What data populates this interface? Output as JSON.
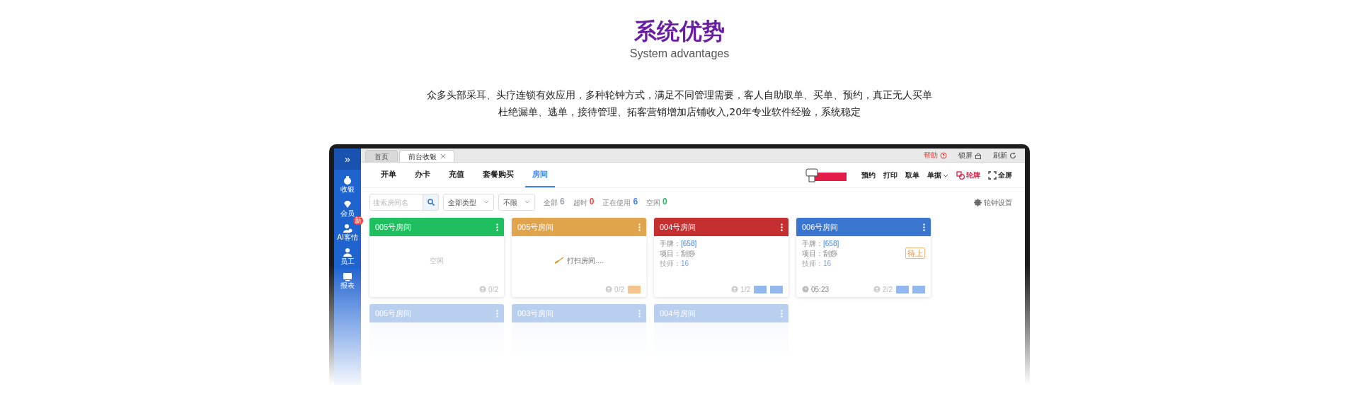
{
  "heading": {
    "title": "系统优势",
    "subtitle": "System advantages",
    "lines": [
      "众多头部采耳、头疗连锁有效应用，多种轮钟方式，满足不同管理需要，客人自助取单、买单、预约，真正无人买单",
      "杜绝漏单、逃单，接待管理、拓客营销增加店铺收入,20年专业软件经验，系统稳定"
    ]
  },
  "app": {
    "sidebar": {
      "toggle": "»",
      "items": [
        {
          "label": "收银"
        },
        {
          "label": "会员"
        },
        {
          "label": "AI客情",
          "badge": "新"
        },
        {
          "label": "员工"
        },
        {
          "label": "报表"
        }
      ]
    },
    "page_tabs": [
      {
        "label": "首页",
        "selected": false
      },
      {
        "label": "前台收银",
        "selected": true,
        "closable": true
      }
    ],
    "top_links": [
      {
        "label": "帮助",
        "kind": "help"
      },
      {
        "label": "锁屏",
        "kind": "lock"
      },
      {
        "label": "刷新",
        "kind": "refresh"
      }
    ],
    "nav_tabs": [
      {
        "label": "开单",
        "selected": false
      },
      {
        "label": "办卡",
        "selected": false
      },
      {
        "label": "充值",
        "selected": false
      },
      {
        "label": "套餐购买",
        "selected": false
      },
      {
        "label": "房间",
        "selected": true
      }
    ],
    "actions": [
      {
        "label": "预约",
        "kind": "plain"
      },
      {
        "label": "打印",
        "kind": "plain"
      },
      {
        "label": "取单",
        "kind": "plain"
      },
      {
        "label": "单据",
        "kind": "dropdown"
      },
      {
        "label": "轮牌",
        "kind": "rotation"
      },
      {
        "label": "全屏",
        "kind": "fullscreen"
      }
    ],
    "filters": {
      "search": {
        "placeholder": "搜索房间名"
      },
      "selects": [
        "全部类型",
        "不限"
      ],
      "counts": [
        {
          "label": "全部",
          "value": "6",
          "color": "#9ca3af"
        },
        {
          "label": "超时",
          "value": "0",
          "color": "#ef4444"
        },
        {
          "label": "正在使用",
          "value": "6",
          "color": "#3b82f6"
        },
        {
          "label": "空闲",
          "value": "0",
          "color": "#22c55e"
        }
      ],
      "settings": "轮钟设置"
    },
    "rooms": [
      {
        "name": "005号房间",
        "color": "#1fbf5f",
        "status": "空闲",
        "kind": "idle",
        "occupancy": "0/2"
      },
      {
        "name": "005号房间",
        "color": "#e0a54c",
        "status": "打扫房间....",
        "kind": "cleaning",
        "occupancy": "0/2",
        "chips": [
          {
            "color": "#f6c48e"
          }
        ]
      },
      {
        "name": "004号房间",
        "color": "#c62f2f",
        "kind": "busy",
        "lines": [
          {
            "label": "手牌：",
            "value": "[658]"
          },
          {
            "label": "项目：",
            "value": "刮痧"
          },
          {
            "label": "技师：",
            "value": "16"
          }
        ],
        "occupancy": "1/2",
        "chips": [
          {
            "color": "#93b8ef"
          },
          {
            "color": "#93b8ef"
          }
        ]
      },
      {
        "name": "006号房间",
        "color": "#3a76cf",
        "kind": "busy",
        "lines": [
          {
            "label": "手牌：",
            "value": "[658]"
          },
          {
            "label": "项目：",
            "value": "刮痧"
          },
          {
            "label": "技师：",
            "value": "16"
          }
        ],
        "tag": "待上",
        "time": "05:23",
        "occupancy": "2/2",
        "chips": [
          {
            "color": "#93b8ef"
          },
          {
            "color": "#93b8ef"
          }
        ]
      }
    ],
    "faded_rooms": [
      "005号房间",
      "003号房间",
      "004号房间"
    ]
  }
}
